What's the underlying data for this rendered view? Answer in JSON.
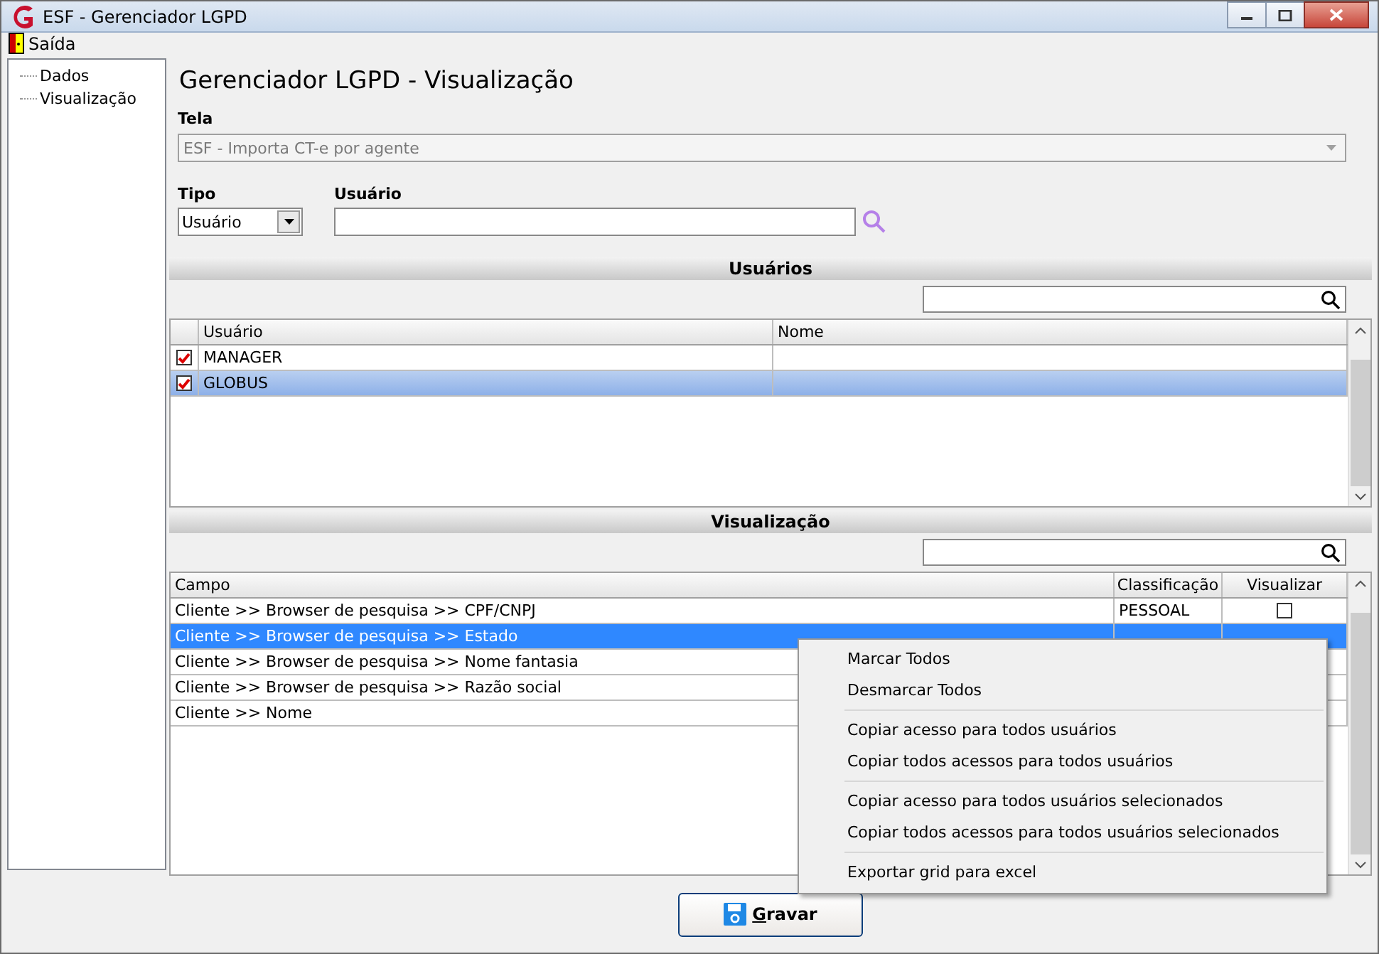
{
  "window": {
    "title": "ESF - Gerenciador LGPD"
  },
  "menu": [
    {
      "label": "Saída"
    }
  ],
  "tree": [
    {
      "label": "Dados"
    },
    {
      "label": "Visualização"
    }
  ],
  "heading": "Gerenciador LGPD - Visualização",
  "tela": {
    "label": "Tela",
    "value": "ESF - Importa CT-e por agente",
    "disabled": true
  },
  "tipo": {
    "label": "Tipo",
    "value": "Usuário"
  },
  "usuario": {
    "label": "Usuário"
  },
  "users": {
    "title": "Usuários",
    "columns": [
      "Usuário",
      "Nome"
    ],
    "rows": [
      {
        "checked": true,
        "selected": false,
        "usuario": "MANAGER"
      },
      {
        "checked": true,
        "selected": true,
        "usuario": "GLOBUS"
      }
    ]
  },
  "fields": {
    "title": "Visualização",
    "columns": [
      "Campo",
      "Classificação",
      "Visualizar"
    ],
    "rows": [
      {
        "selected": false,
        "campo": "Cliente >> Browser de pesquisa >> CPF/CNPJ",
        "classificacao": "PESSOAL",
        "visualizar": false
      },
      {
        "selected": true,
        "campo": "Cliente >> Browser de pesquisa >> Estado"
      },
      {
        "selected": false,
        "campo": "Cliente >> Browser de pesquisa >> Nome fantasia"
      },
      {
        "selected": false,
        "campo": "Cliente >> Browser de pesquisa >> Razão social"
      },
      {
        "selected": false,
        "campo": "Cliente >> Nome"
      }
    ]
  },
  "context_menu": [
    {
      "kind": "item",
      "label": "Marcar Todos"
    },
    {
      "kind": "item",
      "label": "Desmarcar Todos"
    },
    {
      "kind": "separator"
    },
    {
      "kind": "item",
      "label": "Copiar acesso para todos usuários"
    },
    {
      "kind": "item",
      "label": "Copiar todos acessos para todos usuários"
    },
    {
      "kind": "separator"
    },
    {
      "kind": "item",
      "label": "Copiar acesso para todos usuários selecionados"
    },
    {
      "kind": "item",
      "label": "Copiar todos acessos para todos usuários selecionados"
    },
    {
      "kind": "separator"
    },
    {
      "kind": "item",
      "label": "Exportar grid para excel"
    }
  ],
  "save_button": {
    "label": "Gravar"
  }
}
